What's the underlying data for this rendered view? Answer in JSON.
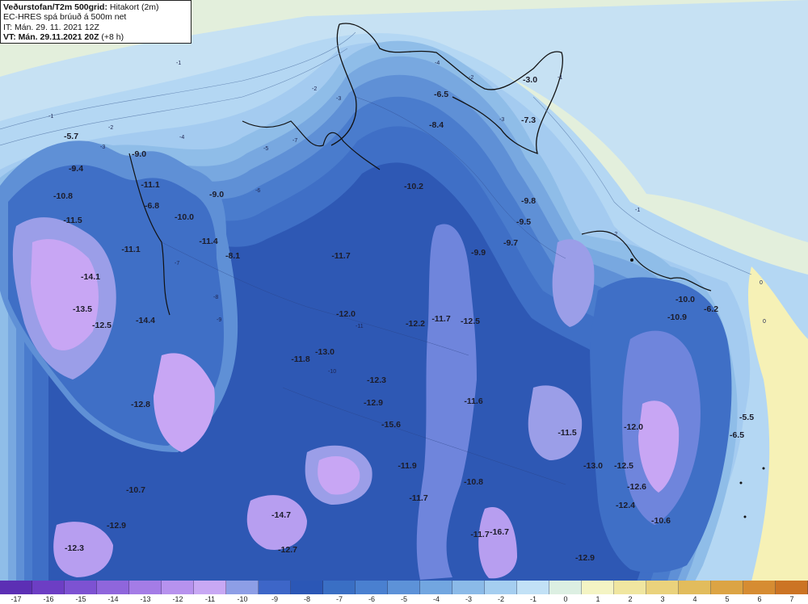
{
  "header": {
    "line1_bold": "Veðurstofan/T2m 500grid:",
    "line1_rest": " Hitakort (2m)",
    "line2": "EC-HRES spá brúuð á 500m net",
    "line3": "IT: Mán. 29. 11. 2021 12Z",
    "line4_bold": "VT: Mán. 29.11.2021 20Z",
    "line4_rest": " (+8 h)"
  },
  "colors": {
    "land_ocean": "#e3efdc",
    "warm_ocean": "#f6f1b6",
    "minus1": "#b4d7f3",
    "minus2": "#a4cbf0",
    "minus3": "#8fbde8",
    "minus4": "#78a8e0",
    "minus5": "#5f90d6",
    "minus7": "#3f6fc6",
    "minus9": "#2e58b4",
    "minus11": "#6f85dc",
    "minus12": "#9b9ee8",
    "minus13": "#b79ef0",
    "minus14": "#c8a6f4"
  },
  "scale": {
    "colors": [
      "#5c2fb4",
      "#6d3ec4",
      "#7d52d2",
      "#8f66dc",
      "#a47ce6",
      "#b792ee",
      "#c8a8f4",
      "#8d9ee6",
      "#3d66c8",
      "#2b57b6",
      "#3a6fc4",
      "#4a80d0",
      "#5d92d8",
      "#72a6e0",
      "#8bbae8",
      "#a5cef0",
      "#c2e1f6",
      "#dcefe2",
      "#f4f4c4",
      "#f0e6a0",
      "#ead27c",
      "#e2bc5c",
      "#dca444",
      "#d68c32",
      "#cc7424"
    ],
    "ticks": [
      "-17",
      "-16",
      "-15",
      "-14",
      "-13",
      "-12",
      "-11",
      "-10",
      "-9",
      "-8",
      "-7",
      "-6",
      "-5",
      "-4",
      "-3",
      "-2",
      "-1",
      "0",
      "1",
      "2",
      "3",
      "4",
      "5",
      "6",
      "7"
    ]
  },
  "values": [
    {
      "t": "-5.7"
    },
    {
      "t": "-9.4"
    },
    {
      "t": "-9.0"
    },
    {
      "t": "-10.8"
    },
    {
      "t": "-11.1"
    },
    {
      "t": "-9.0"
    },
    {
      "t": "-6.8"
    },
    {
      "t": "-11.5"
    },
    {
      "t": "-10.0"
    },
    {
      "t": "-11.4"
    },
    {
      "t": "-11.1"
    },
    {
      "t": "-8.1"
    },
    {
      "t": "-14.1"
    },
    {
      "t": "-13.5"
    },
    {
      "t": "-12.5"
    },
    {
      "t": "-14.4"
    },
    {
      "t": "-12.8"
    },
    {
      "t": "-10.7"
    },
    {
      "t": "-12.9"
    },
    {
      "t": "-12.3"
    },
    {
      "t": "-3.0"
    },
    {
      "t": "-6.5"
    },
    {
      "t": "-7.3"
    },
    {
      "t": "-8.4"
    },
    {
      "t": "-10.2"
    },
    {
      "t": "-9.8"
    },
    {
      "t": "-9.5"
    },
    {
      "t": "-9.7"
    },
    {
      "t": "-9.9"
    },
    {
      "t": "-11.7"
    },
    {
      "t": "-12.0"
    },
    {
      "t": "-12.2"
    },
    {
      "t": "-11.7"
    },
    {
      "t": "-12.5"
    },
    {
      "t": "-13.0"
    },
    {
      "t": "-11.8"
    },
    {
      "t": "-12.3"
    },
    {
      "t": "-12.9"
    },
    {
      "t": "-15.6"
    },
    {
      "t": "-11.6"
    },
    {
      "t": "-11.5"
    },
    {
      "t": "-11.9"
    },
    {
      "t": "-10.8"
    },
    {
      "t": "-11.7"
    },
    {
      "t": "-14.7"
    },
    {
      "t": "-12.7"
    },
    {
      "t": "-11.7"
    },
    {
      "t": "-16.7"
    },
    {
      "t": "-13.0"
    },
    {
      "t": "-12.5"
    },
    {
      "t": "-12.9"
    },
    {
      "t": "-10.0"
    },
    {
      "t": "-6.2"
    },
    {
      "t": "-10.9"
    },
    {
      "t": "-12.0"
    },
    {
      "t": "-5.5"
    },
    {
      "t": "-6.5"
    },
    {
      "t": "-12.6"
    },
    {
      "t": "-12.4"
    },
    {
      "t": "-10.6"
    }
  ],
  "contour_labels": [
    "-1",
    "-2",
    "-3",
    "-5",
    "-7",
    "-4",
    "-1",
    "-2",
    "-3",
    "0",
    "0",
    "-1",
    "-2",
    "-6",
    "-8",
    "-10",
    "-11",
    "-9",
    "-7",
    "-5",
    "-4",
    "-3",
    "-2",
    "-1"
  ]
}
